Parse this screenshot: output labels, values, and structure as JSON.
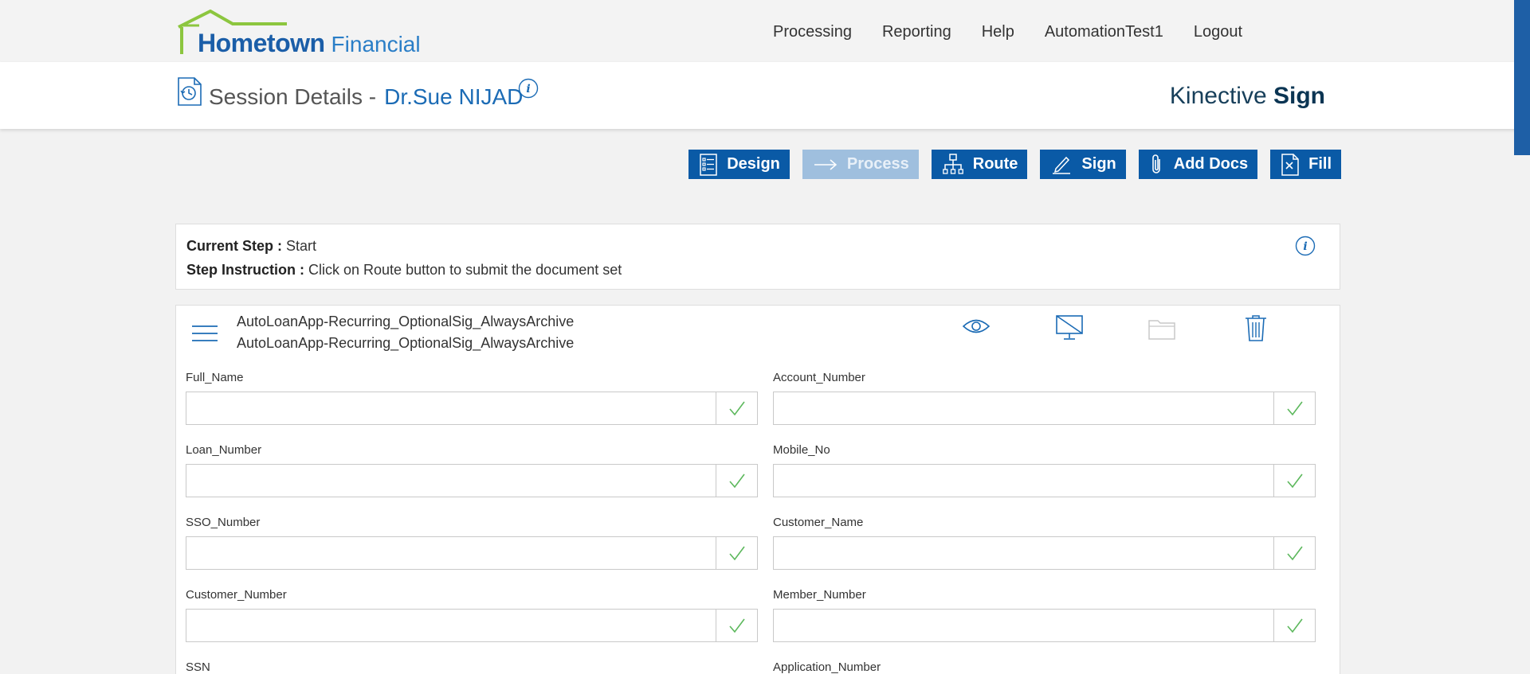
{
  "header": {
    "logo": {
      "brand": "Hometown",
      "suffix": "Financial"
    },
    "nav": [
      "Processing",
      "Reporting",
      "Help",
      "AutomationTest1",
      "Logout"
    ]
  },
  "session": {
    "title": "Session Details -",
    "name": "Dr.Sue NIJAD",
    "product_light": "Kinective",
    "product_bold": "Sign"
  },
  "actions": [
    {
      "label": "Design",
      "icon": "list-icon",
      "enabled": true
    },
    {
      "label": "Process",
      "icon": "arrow-right-icon",
      "enabled": false
    },
    {
      "label": "Route",
      "icon": "network-icon",
      "enabled": true
    },
    {
      "label": "Sign",
      "icon": "pen-icon",
      "enabled": true
    },
    {
      "label": "Add Docs",
      "icon": "paperclip-icon",
      "enabled": true
    },
    {
      "label": "Fill",
      "icon": "file-x-icon",
      "enabled": true
    }
  ],
  "step": {
    "current_label": "Current Step :",
    "current_value": "Start",
    "instruction_label": "Step Instruction :",
    "instruction_value": "Click on Route button to submit the document set"
  },
  "document": {
    "name_line1": "AutoLoanApp-Recurring_OptionalSig_AlwaysArchive",
    "name_line2": "AutoLoanApp-Recurring_OptionalSig_AlwaysArchive",
    "fields_left": [
      {
        "label": "Full_Name",
        "value": ""
      },
      {
        "label": "Loan_Number",
        "value": ""
      },
      {
        "label": "SSO_Number",
        "value": ""
      },
      {
        "label": "Customer_Number",
        "value": ""
      },
      {
        "label": "SSN",
        "value": ""
      }
    ],
    "fields_right": [
      {
        "label": "Account_Number",
        "value": ""
      },
      {
        "label": "Mobile_No",
        "value": ""
      },
      {
        "label": "Customer_Name",
        "value": ""
      },
      {
        "label": "Member_Number",
        "value": ""
      },
      {
        "label": "Application_Number",
        "value": ""
      }
    ]
  },
  "colors": {
    "primary": "#0a5aa6",
    "disabled": "#9fbfde",
    "check": "#5cb85c"
  }
}
